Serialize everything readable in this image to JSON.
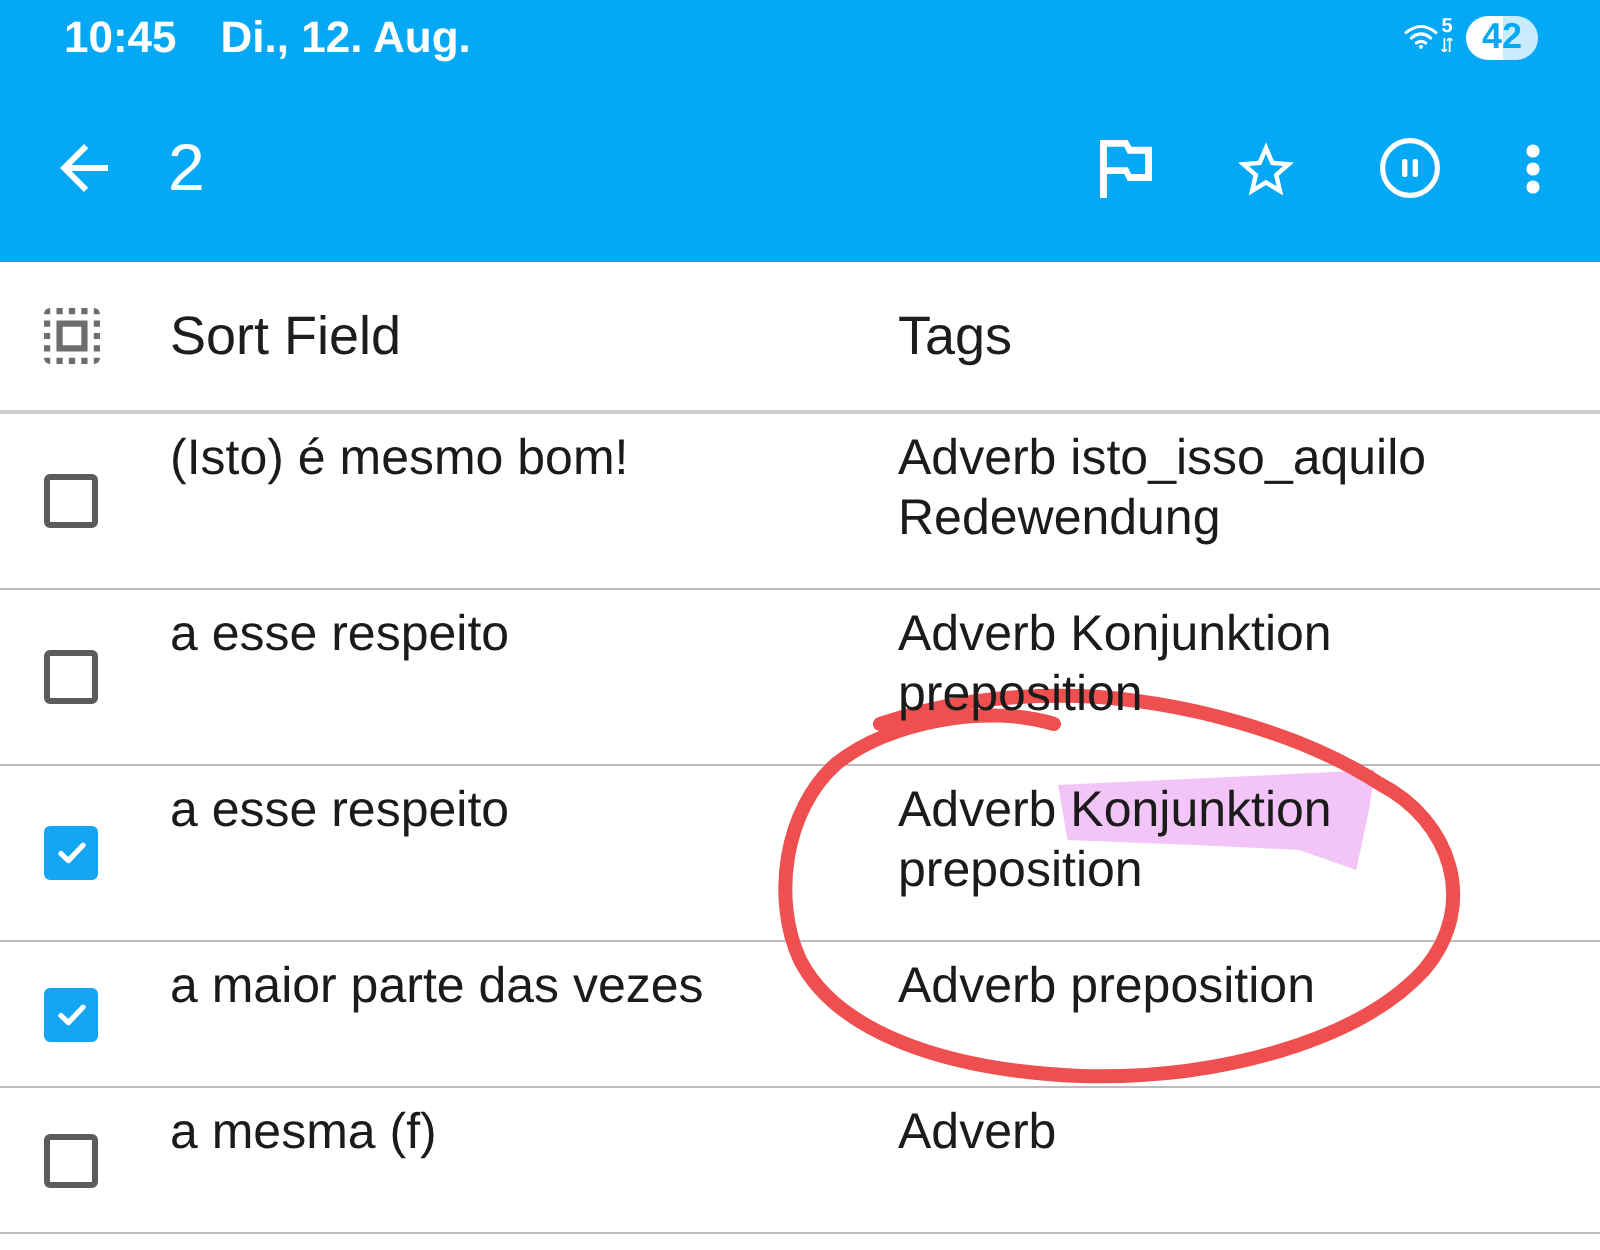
{
  "status_bar": {
    "time": "10:45",
    "date": "Di., 12. Aug.",
    "wifi_badge": "5",
    "battery": "42"
  },
  "app_bar": {
    "title": "2",
    "actions": [
      {
        "kind": "flag"
      },
      {
        "kind": "star"
      },
      {
        "kind": "pause"
      },
      {
        "kind": "more"
      }
    ]
  },
  "table": {
    "columns": [
      "Sort Field",
      "Tags"
    ],
    "rows": [
      {
        "checked": false,
        "sort_field": "(Isto) é mesmo bom!",
        "tags": [
          {
            "text": "Adverb",
            "highlighted": false
          },
          {
            "text": "isto_isso_aquilo",
            "highlighted": false
          },
          {
            "text": "Redewendung",
            "highlighted": false
          }
        ]
      },
      {
        "checked": false,
        "sort_field": "a esse respeito",
        "tags": [
          {
            "text": "Adverb",
            "highlighted": false
          },
          {
            "text": "Konjunktion",
            "highlighted": false
          },
          {
            "text": "preposition",
            "highlighted": false
          }
        ]
      },
      {
        "checked": true,
        "sort_field": "a esse respeito",
        "tags": [
          {
            "text": "Adverb",
            "highlighted": false
          },
          {
            "text": "Konjunktion",
            "highlighted": true
          },
          {
            "text": "preposition",
            "highlighted": false
          }
        ]
      },
      {
        "checked": true,
        "sort_field": "a maior parte das vezes",
        "tags": [
          {
            "text": "Adverb",
            "highlighted": false
          },
          {
            "text": "preposition",
            "highlighted": false
          }
        ]
      },
      {
        "checked": false,
        "sort_field": "a mesma (f)",
        "tags": [
          {
            "text": "Adverb",
            "highlighted": false
          }
        ]
      }
    ]
  },
  "annotations": [
    {
      "kind": "ink_circle"
    }
  ]
}
